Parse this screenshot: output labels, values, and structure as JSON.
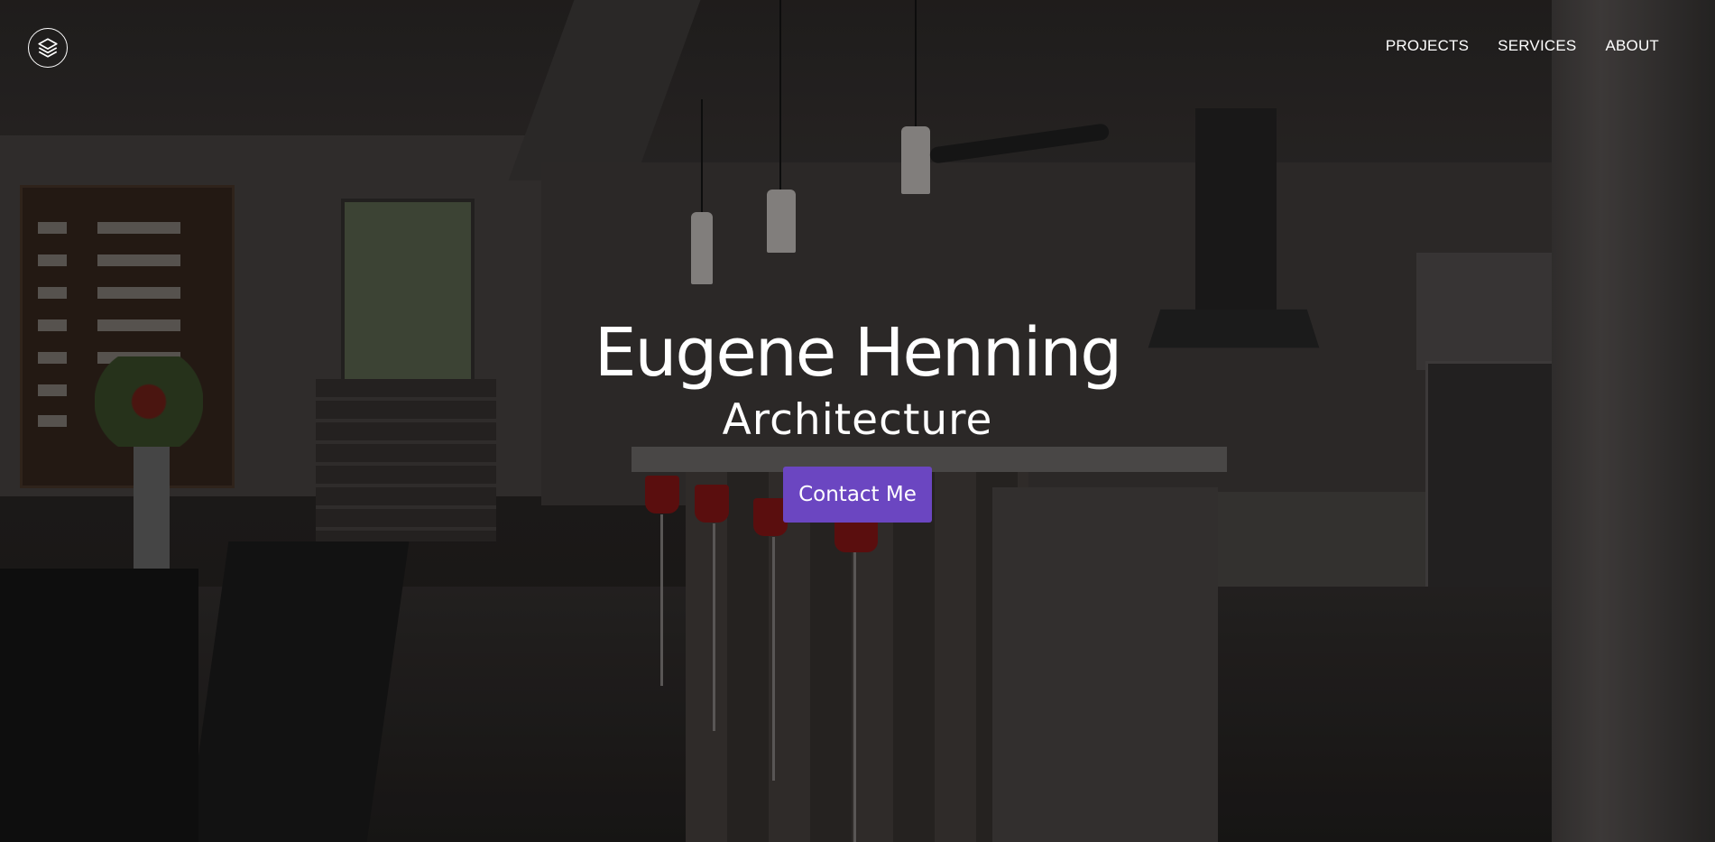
{
  "brand": {
    "logo_icon": "layers-icon",
    "color": "#ffffff"
  },
  "nav": {
    "items": [
      {
        "label": "PROJECTS"
      },
      {
        "label": "SERVICES"
      },
      {
        "label": "ABOUT"
      }
    ]
  },
  "hero": {
    "title": "Eugene Henning",
    "subtitle": "Architecture",
    "cta_label": "Contact Me",
    "cta_color": "#6b46c1",
    "background": "dark-kitchen-interior-photo"
  }
}
